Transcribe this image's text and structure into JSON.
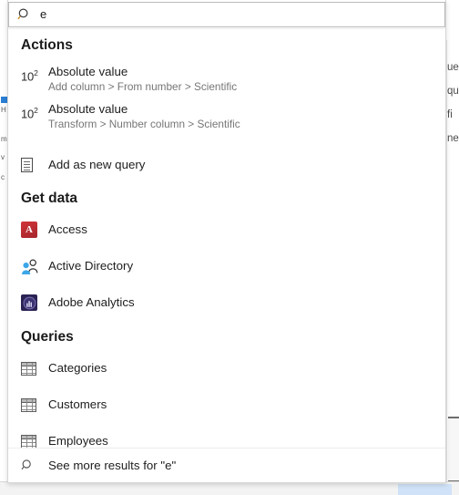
{
  "search": {
    "value": "e",
    "placeholder": "Search",
    "icon": "search-icon"
  },
  "sections": [
    {
      "id": "actions",
      "header": "Actions",
      "items": [
        {
          "icon": "scientific-notation-icon",
          "icon_text": "10",
          "icon_sup": "2",
          "title": "Absolute value",
          "subtitle": "Add column > From number > Scientific"
        },
        {
          "icon": "scientific-notation-icon",
          "icon_text": "10",
          "icon_sup": "2",
          "title": "Absolute value",
          "subtitle": "Transform > Number column > Scientific"
        },
        {
          "icon": "document-icon",
          "title": "Add as new query",
          "subtitle": ""
        }
      ]
    },
    {
      "id": "get-data",
      "header": "Get data",
      "items": [
        {
          "icon": "access-icon",
          "icon_glyph": "A",
          "title": "Access",
          "subtitle": ""
        },
        {
          "icon": "active-directory-icon",
          "title": "Active Directory",
          "subtitle": ""
        },
        {
          "icon": "adobe-analytics-icon",
          "title": "Adobe Analytics",
          "subtitle": ""
        }
      ]
    },
    {
      "id": "queries",
      "header": "Queries",
      "items": [
        {
          "icon": "table-icon",
          "title": "Categories",
          "subtitle": ""
        },
        {
          "icon": "table-icon",
          "title": "Customers",
          "subtitle": ""
        },
        {
          "icon": "table-icon",
          "title": "Employees",
          "subtitle": ""
        }
      ]
    }
  ],
  "footer": {
    "icon": "search-icon",
    "label": "See more results for \"e\""
  },
  "background": {
    "right_fragments": [
      "ue",
      "qu",
      "fi",
      "ne"
    ],
    "left_fragments": [
      "H",
      "m",
      "v",
      "c"
    ]
  },
  "colors": {
    "accent": "#2a7fd4",
    "access_red": "#a4262c",
    "adobe_purple": "#2b2254",
    "text_primary": "#1d1d1d",
    "text_secondary": "#767676",
    "panel_border": "#d6d6d6",
    "selection_blue": "#cfe2f7"
  }
}
